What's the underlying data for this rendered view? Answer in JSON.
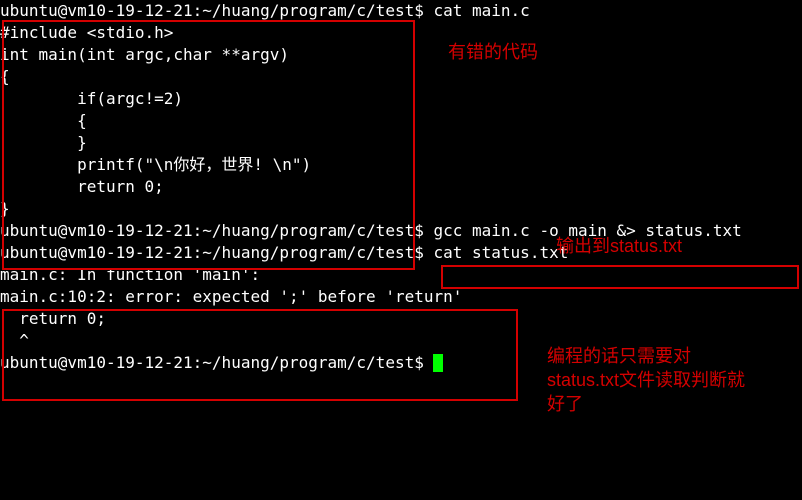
{
  "prompt": "ubuntu@vm10-19-12-21:~/huang/program/c/test$ ",
  "commands": {
    "cat_main": "cat main.c",
    "gcc": "gcc main.c -o main &> status.txt",
    "cat_status": "cat status.txt",
    "blank": ""
  },
  "source_lines": [
    "#include <stdio.h>",
    "",
    "int main(int argc,char **argv)",
    "{",
    "        if(argc!=2)",
    "        {",
    "",
    "        }",
    "        printf(\"\\n你好，世界! \\n\")",
    "        return 0;",
    "}"
  ],
  "error_lines": [
    "main.c: In function 'main':",
    "main.c:10:2: error: expected ';' before 'return'",
    "  return 0;",
    "  ^"
  ],
  "annotations": {
    "code_box_label": "有错的代码",
    "gcc_label": "输出到status.txt",
    "status_label": "编程的话只需要对\nstatus.txt文件读取判断就\n好了"
  }
}
